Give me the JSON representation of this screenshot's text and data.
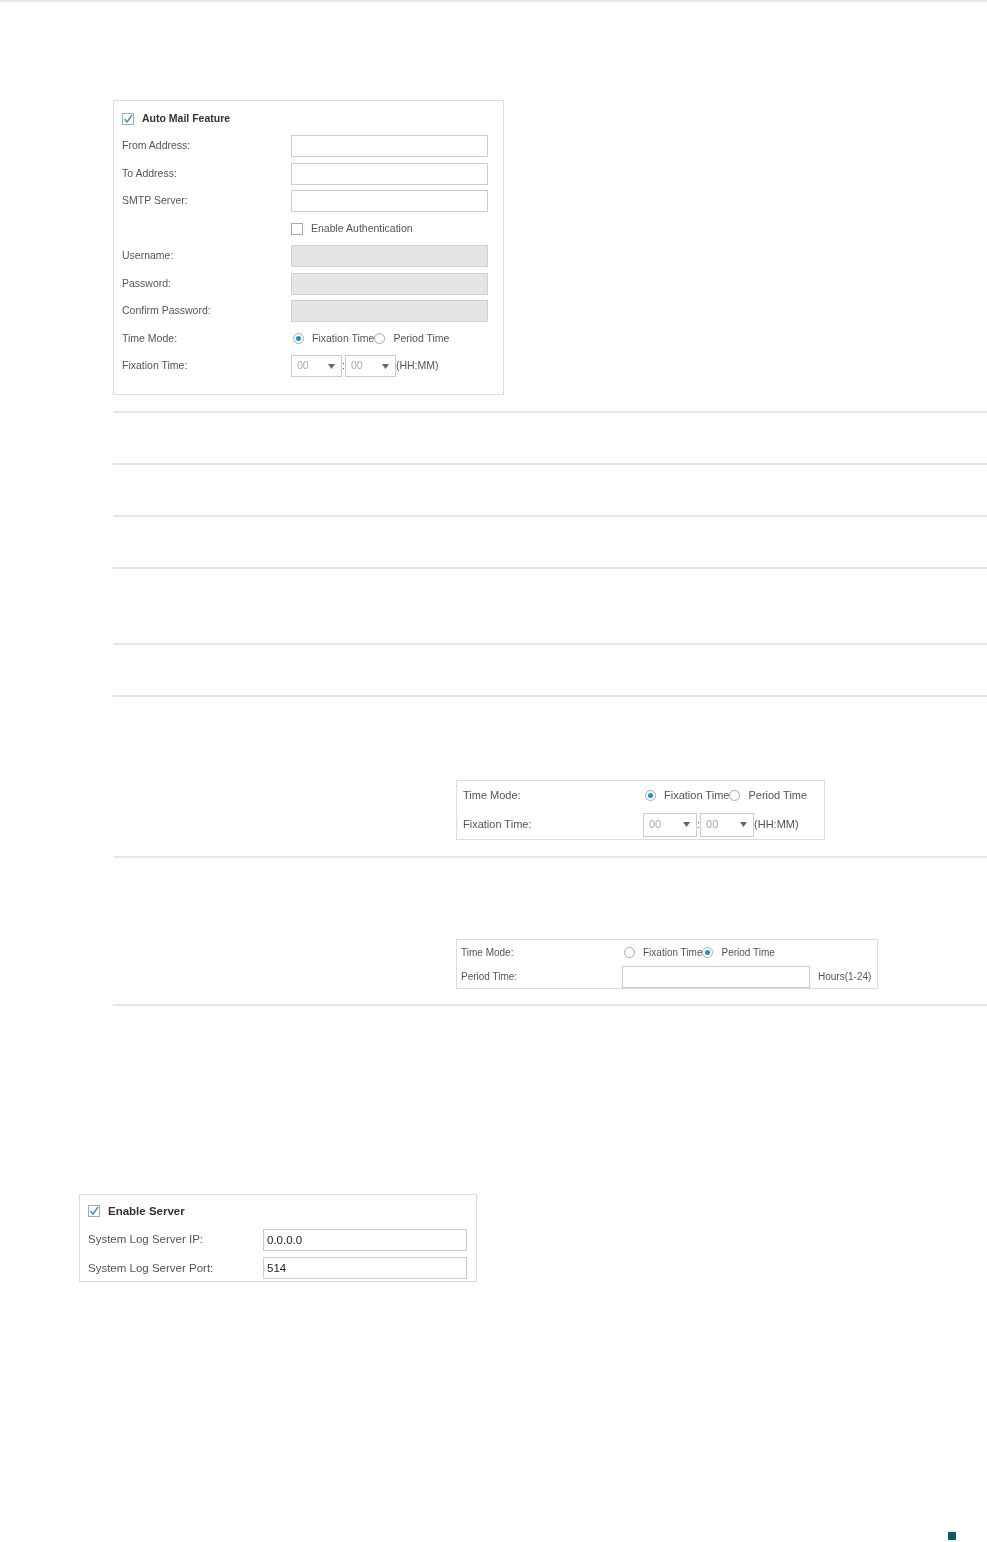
{
  "mail_panel": {
    "feature": {
      "label": "Auto Mail Feature",
      "checked": true
    },
    "fields": [
      {
        "kind": "text",
        "label": "From Address:",
        "disabled": false
      },
      {
        "kind": "text",
        "label": "To Address:",
        "disabled": false
      },
      {
        "kind": "text",
        "label": "SMTP Server:",
        "disabled": false
      },
      {
        "kind": "checkbox",
        "label": "Enable Authentication",
        "checked": false
      },
      {
        "kind": "text",
        "label": "Username:",
        "disabled": true
      },
      {
        "kind": "text",
        "label": "Password:",
        "disabled": true
      },
      {
        "kind": "text",
        "label": "Confirm Password:",
        "disabled": true
      },
      {
        "kind": "radio",
        "label": "Time Mode:",
        "options": [
          {
            "label": "Fixation Time",
            "selected": true
          },
          {
            "label": "Period Time",
            "selected": false
          }
        ]
      },
      {
        "kind": "time",
        "label": "Fixation Time:",
        "hour": "00",
        "separator": ":",
        "minute": "00",
        "hint": "(HH:MM)"
      }
    ]
  },
  "fixation_example": {
    "fields": [
      {
        "kind": "radio",
        "label": "Time Mode:",
        "options": [
          {
            "label": "Fixation Time",
            "selected": true
          },
          {
            "label": "Period Time",
            "selected": false
          }
        ]
      },
      {
        "kind": "time",
        "label": "Fixation Time:",
        "hour": "00",
        "separator": ":",
        "minute": "00",
        "hint": "(HH:MM)"
      }
    ]
  },
  "period_example": {
    "fields": [
      {
        "kind": "radio",
        "label": "Time Mode:",
        "options": [
          {
            "label": "Fixation Time",
            "selected": false
          },
          {
            "label": "Period Time",
            "selected": true
          }
        ]
      },
      {
        "kind": "text",
        "label": "Period Time:",
        "disabled": false,
        "unit": "Hours(1-24)"
      }
    ]
  },
  "server_panel": {
    "feature": {
      "label": "Enable Server",
      "checked": true
    },
    "fields": [
      {
        "kind": "text",
        "label": "System Log Server IP:",
        "value": "0.0.0.0",
        "disabled": false
      },
      {
        "kind": "text",
        "label": "System Log Server Port:",
        "value": "514",
        "disabled": false
      }
    ]
  }
}
